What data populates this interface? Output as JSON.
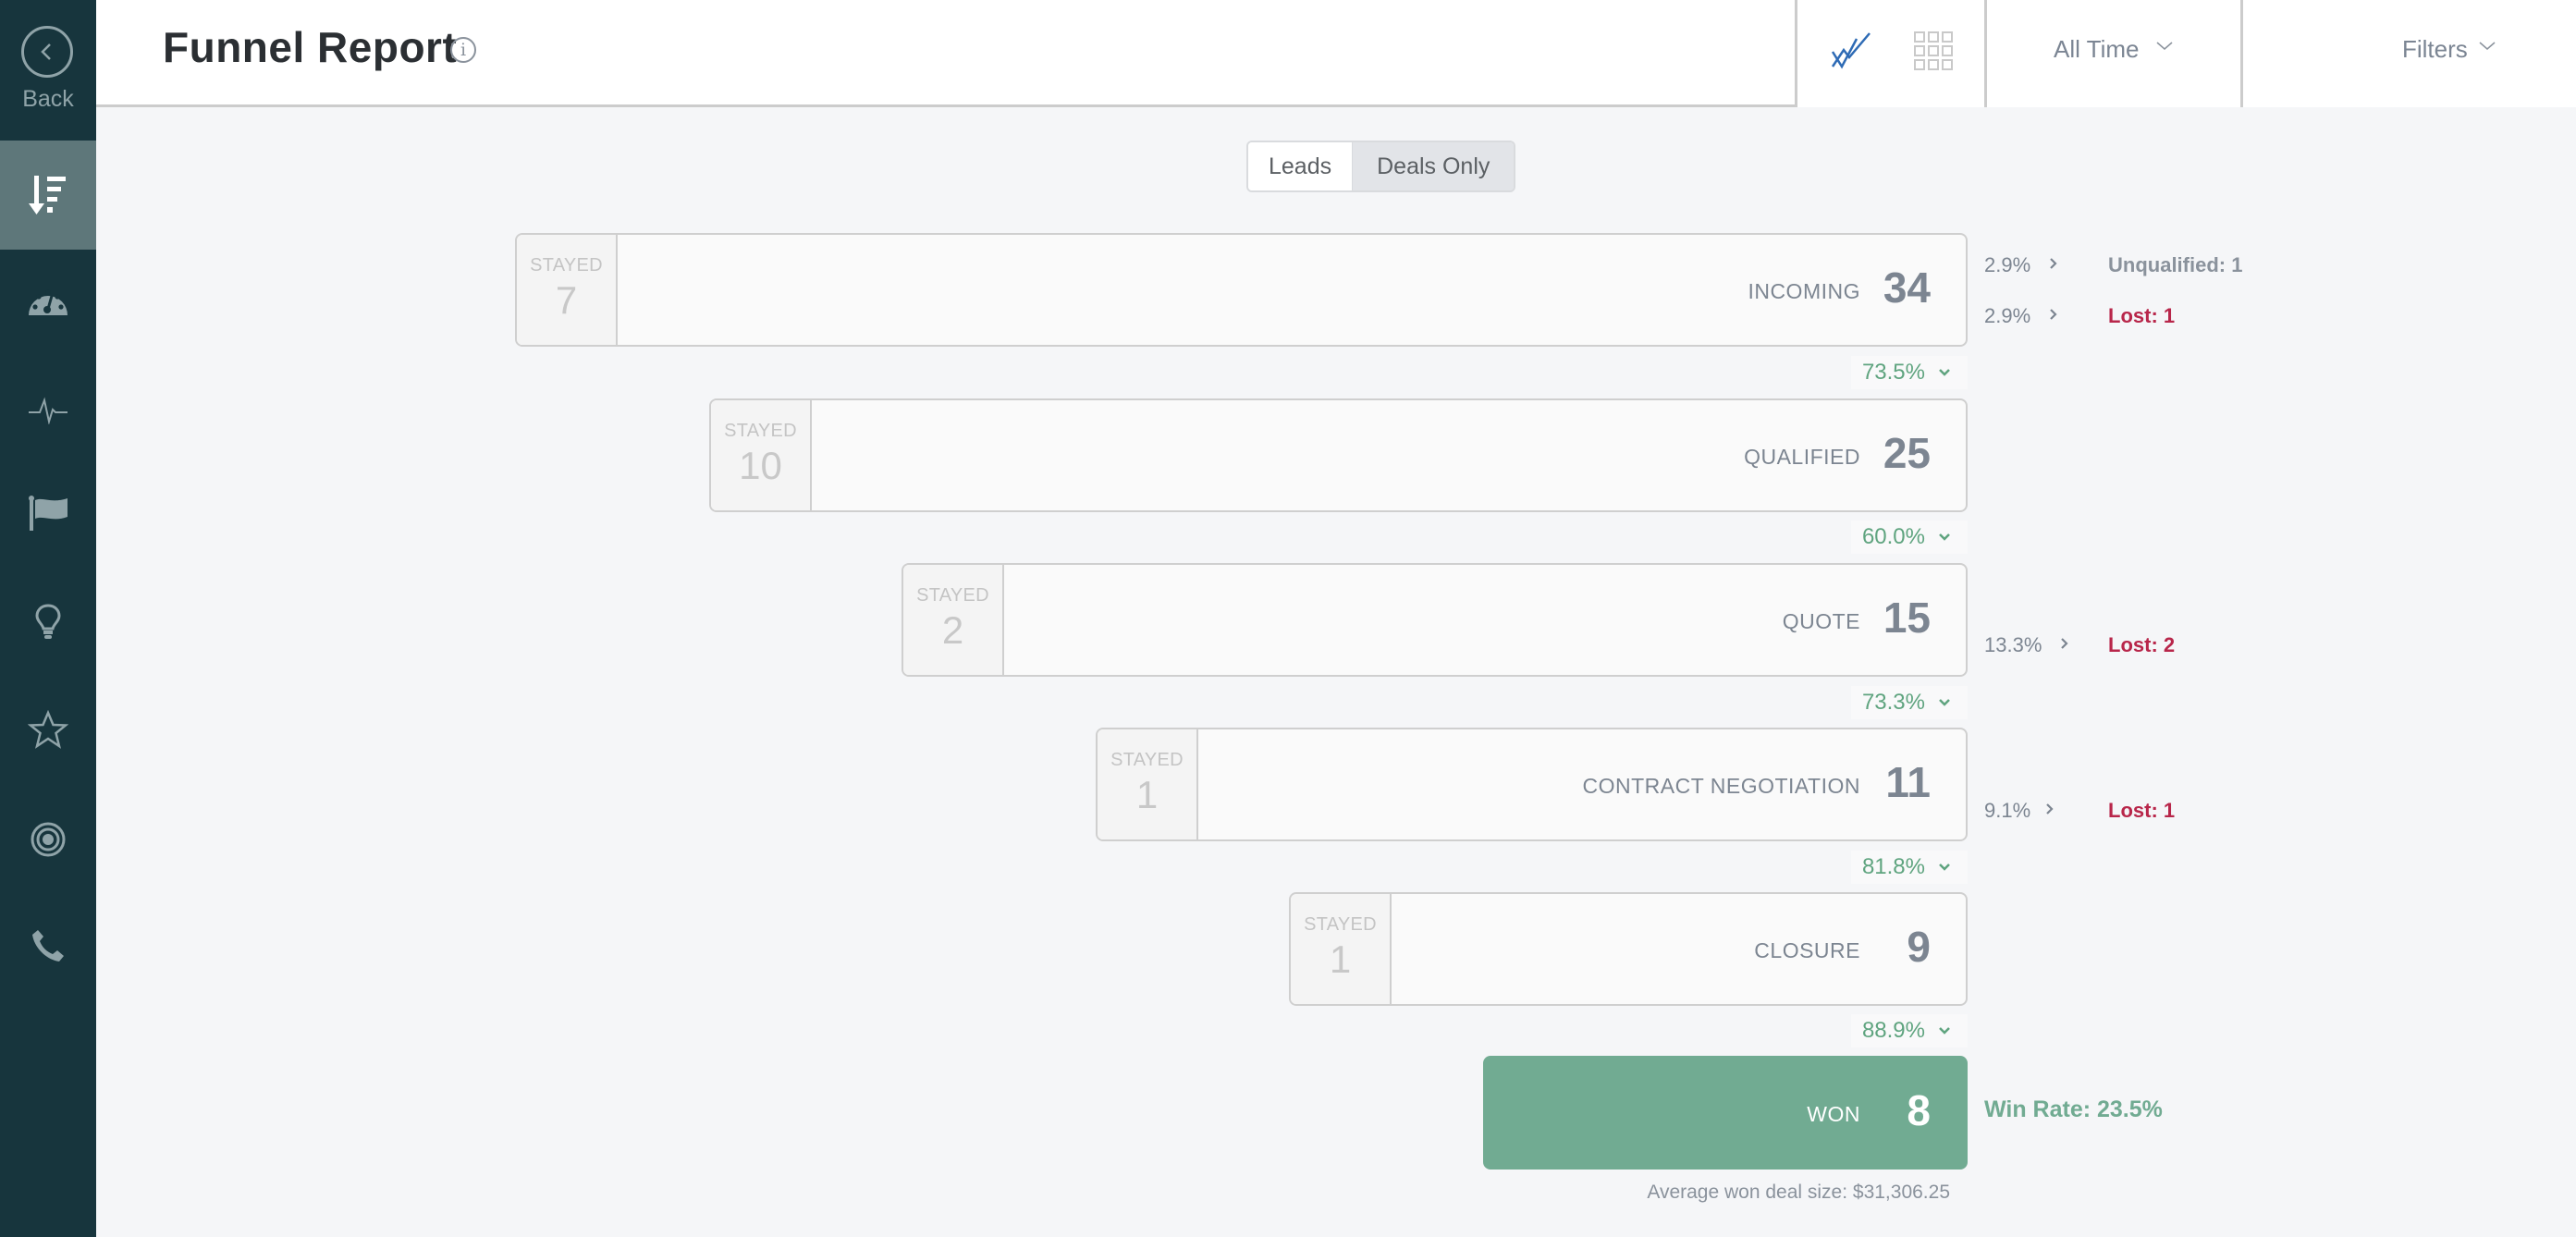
{
  "sidebar": {
    "back_label": "Back",
    "items": [
      {
        "name": "funnel",
        "icon": "funnel-sort-icon",
        "active": true
      },
      {
        "name": "dashboard",
        "icon": "speedometer-icon",
        "active": false
      },
      {
        "name": "activity",
        "icon": "pulse-icon",
        "active": false
      },
      {
        "name": "goals",
        "icon": "flag-icon",
        "active": false
      },
      {
        "name": "insights",
        "icon": "lightbulb-icon",
        "active": false
      },
      {
        "name": "favorites",
        "icon": "star-icon",
        "active": false
      },
      {
        "name": "targets",
        "icon": "target-icon",
        "active": false
      },
      {
        "name": "calls",
        "icon": "phone-icon",
        "active": false
      }
    ]
  },
  "header": {
    "title": "Funnel Report",
    "info_icon": "i",
    "views": [
      {
        "name": "trend-view",
        "icon": "trend-check-icon",
        "active": true
      },
      {
        "name": "grid-view",
        "icon": "grid-icon",
        "active": false
      }
    ],
    "time_range": "All Time",
    "filters_label": "Filters"
  },
  "toggle": {
    "options": [
      "Leads",
      "Deals Only"
    ],
    "selected": "Deals Only"
  },
  "funnel": {
    "stayed_label": "STAYED",
    "stages": [
      {
        "name": "INCOMING",
        "count": "34",
        "stayed": "7"
      },
      {
        "name": "QUALIFIED",
        "count": "25",
        "stayed": "10"
      },
      {
        "name": "QUOTE",
        "count": "15",
        "stayed": "2"
      },
      {
        "name": "CONTRACT NEGOTIATION",
        "count": "11",
        "stayed": "1"
      },
      {
        "name": "CLOSURE",
        "count": "9",
        "stayed": "1"
      },
      {
        "name": "WON",
        "count": "8"
      }
    ],
    "conversions": [
      "73.5%",
      "60.0%",
      "73.3%",
      "81.8%",
      "88.9%"
    ],
    "exits": [
      {
        "stage": "INCOMING",
        "pct": "2.9%",
        "label": "Unqualified: 1",
        "type": "unqualified"
      },
      {
        "stage": "INCOMING",
        "pct": "2.9%",
        "label": "Lost: 1",
        "type": "lost"
      },
      {
        "stage": "QUOTE",
        "pct": "13.3%",
        "label": "Lost: 2",
        "type": "lost"
      },
      {
        "stage": "CONTRACT NEGOTIATION",
        "pct": "9.1%",
        "label": "Lost: 1",
        "type": "lost"
      }
    ],
    "win_rate": "Win Rate: 23.5%",
    "avg_won_deal": "Average won deal size: $31,306.25"
  },
  "colors": {
    "sidebar_bg": "#17353d",
    "sidebar_active": "#5e777a",
    "won_green": "#71ab92",
    "conversion_green": "#5fa47f",
    "lost_red": "#b8264a",
    "accent_blue": "#2e6bb5"
  }
}
